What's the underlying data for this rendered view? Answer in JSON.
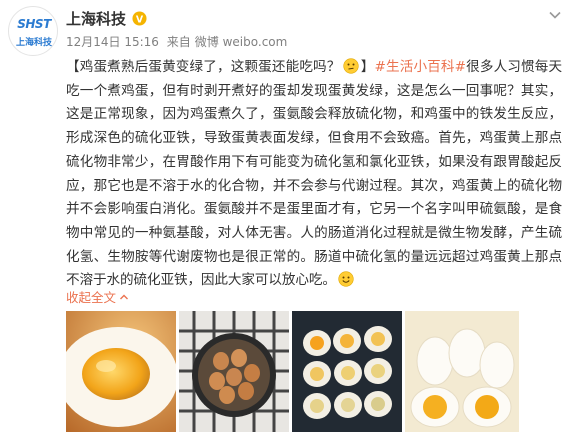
{
  "account": {
    "name": "上海科技",
    "avatar_top": "SHST",
    "avatar_bottom": "上海科技"
  },
  "meta": {
    "date": "12月14日 15:16",
    "source_label": "来自",
    "source": "微博 weibo.com"
  },
  "post": {
    "segments": [
      {
        "text": "【鸡蛋煮熟后蛋黄变绿了，这颗蛋还能吃吗？",
        "kind": "text"
      },
      {
        "text": "",
        "kind": "emoji-think"
      },
      {
        "text": "】",
        "kind": "text"
      },
      {
        "text": "#生活小百科#",
        "kind": "tag"
      },
      {
        "text": "很多人习惯每天吃一个煮鸡蛋，但有时剥开煮好的蛋却发现蛋黄发绿，这是怎么一回事呢？其实，这是正常现象，因为鸡蛋煮久了，蛋氨酸会释放硫化物，和鸡蛋中的铁发生反应，形成深色的硫化亚铁，导致蛋黄表面发绿，但食用不会致癌。首先，鸡蛋黄上那点硫化物非常少，在胃酸作用下有可能变为硫化氢和氯化亚铁，如果没有跟胃酸起反应，那它也是不溶于水的化合物，并不会参与代谢过程。其次，鸡蛋黄上的硫化物并不会影响蛋白消化。蛋氨酸并不是蛋里面才有，它另一个名字叫甲硫氨酸，是食物中常见的一种氨基酸，对人体无害。人的肠道消化过程就是微生物发酵，产生硫化氢、生物胺等代谢废物也是很正常的。肠道中硫化氢的量远远超过鸡蛋黄上那点不溶于水的硫化亚铁，因此大家可以放心吃。",
        "kind": "text"
      },
      {
        "text": "",
        "kind": "emoji-smile"
      }
    ]
  },
  "actions": {
    "collapse_label": "收起全文"
  },
  "colors": {
    "link": "#eb7350",
    "meta": "#808080",
    "text": "#333333",
    "verified": "#f5b400"
  }
}
